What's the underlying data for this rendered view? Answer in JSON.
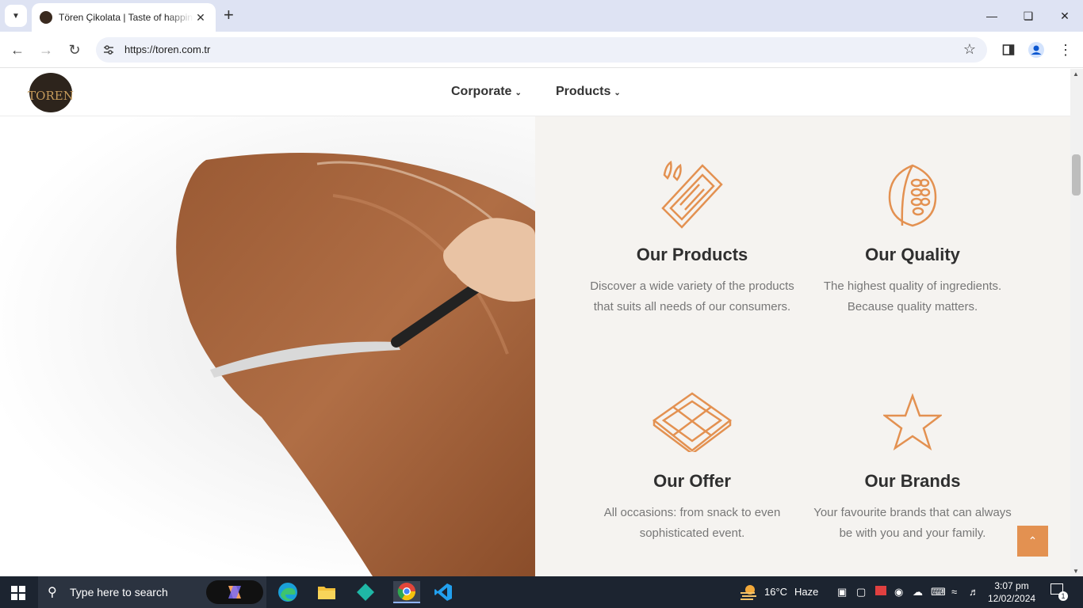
{
  "browser": {
    "tab_title": "Tören Çikolata | Taste of happiness",
    "url": "https://toren.com.tr"
  },
  "site": {
    "logo_text": "TOREN",
    "nav": [
      {
        "label": "Corporate"
      },
      {
        "label": "Products"
      }
    ],
    "features": [
      {
        "title": "Our Products",
        "text": "Discover a wide variety of the products that suits all needs of our consumers.",
        "icon": "snack-bar-icon"
      },
      {
        "title": "Our Quality",
        "text": "The highest quality of ingredients. Because quality matters.",
        "icon": "cocoa-pod-icon"
      },
      {
        "title": "Our Offer",
        "text": "All occasions: from snack to even sophisticated event.",
        "icon": "chocolate-bar-icon"
      },
      {
        "title": "Our Brands",
        "text": "Your favourite brands that can always be with you and your family.",
        "icon": "star-icon"
      }
    ],
    "accent_color": "#e39151"
  },
  "taskbar": {
    "search_placeholder": "Type here to search",
    "weather_temp": "16°C",
    "weather_desc": "Haze",
    "time": "3:07 pm",
    "date": "12/02/2024",
    "notification_count": "1"
  }
}
